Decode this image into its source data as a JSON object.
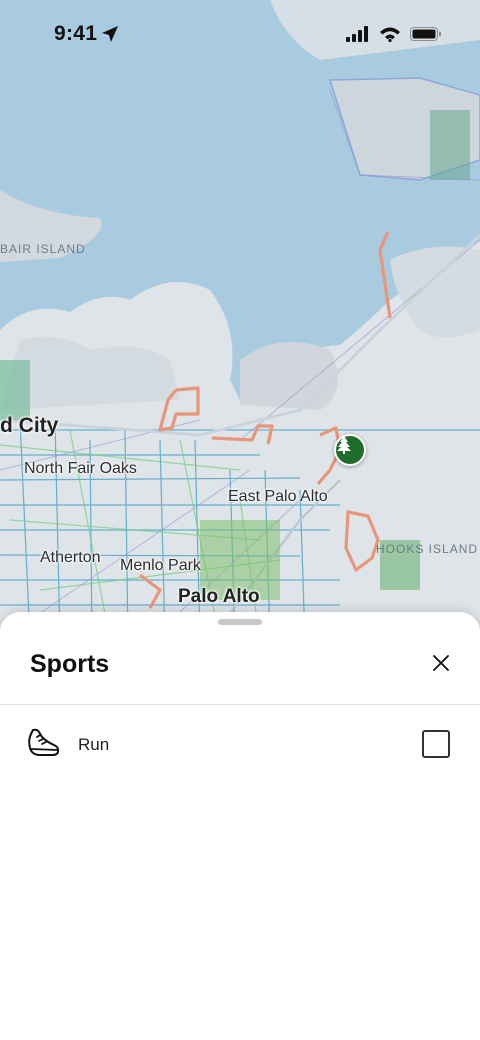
{
  "status_bar": {
    "time": "9:41"
  },
  "map": {
    "labels": {
      "bair_island": "BAIR ISLAND",
      "redwood_city": "d City",
      "north_fair_oaks": "North Fair Oaks",
      "east_palo_alto": "East Palo Alto",
      "hooks_island": "HOOKS ISLAND",
      "atherton": "Atherton",
      "menlo_park": "Menlo Park",
      "palo_alto": "Palo Alto"
    },
    "colors": {
      "water": "#a9cbe0",
      "land": "#dfe4e8",
      "route": "#e8957a",
      "park": "#1f6d2a"
    }
  },
  "sheet": {
    "title": "Sports",
    "items": [
      {
        "label": "Run",
        "icon": "running-shoe-icon",
        "checked": false
      }
    ]
  }
}
